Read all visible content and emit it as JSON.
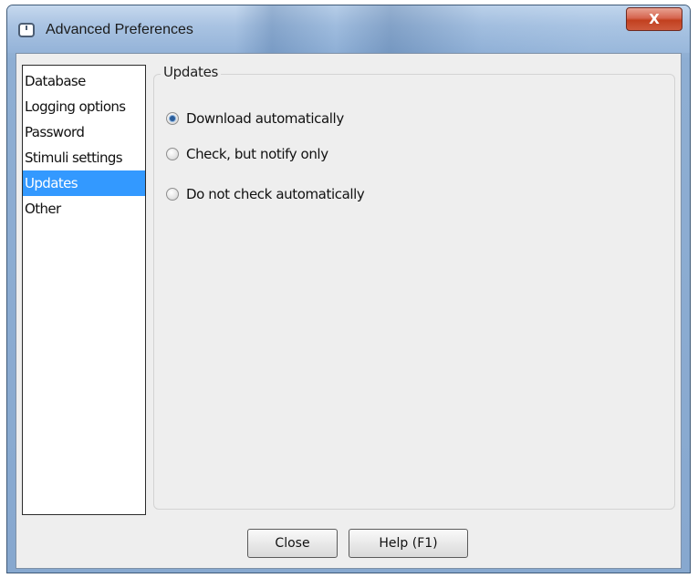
{
  "window": {
    "title": "Advanced Preferences",
    "close_glyph": "X"
  },
  "sidebar": {
    "items": [
      {
        "label": "Database",
        "selected": false
      },
      {
        "label": "Logging options",
        "selected": false
      },
      {
        "label": "Password",
        "selected": false
      },
      {
        "label": "Stimuli settings",
        "selected": false
      },
      {
        "label": "Updates",
        "selected": true
      },
      {
        "label": "Other",
        "selected": false
      }
    ]
  },
  "panel": {
    "group_title": "Updates",
    "options": [
      {
        "label": "Download automatically",
        "checked": true
      },
      {
        "label": "Check, but notify only",
        "checked": false
      },
      {
        "label": "Do not check automatically",
        "checked": false
      }
    ]
  },
  "buttons": {
    "close_label": "Close",
    "help_label": "Help (F1)"
  },
  "colors": {
    "selection": "#3399ff",
    "title_close": "#c2401f"
  },
  "icons": {
    "app": "app-window-icon",
    "close": "close-icon"
  }
}
